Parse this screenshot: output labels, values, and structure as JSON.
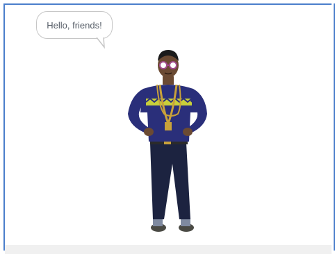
{
  "speech_bubble": {
    "text": "Hello, friends!"
  },
  "sprite": {
    "icon": "person-sprite-icon"
  },
  "colors": {
    "stage_border": "#4a7ecb",
    "bubble_border": "#c6c6c6",
    "bubble_text": "#555c66",
    "sweater": "#2a2f7a",
    "sweater_pattern": "#c8cf3a",
    "jeans": "#1c2340",
    "chain": "#c9a23a"
  }
}
